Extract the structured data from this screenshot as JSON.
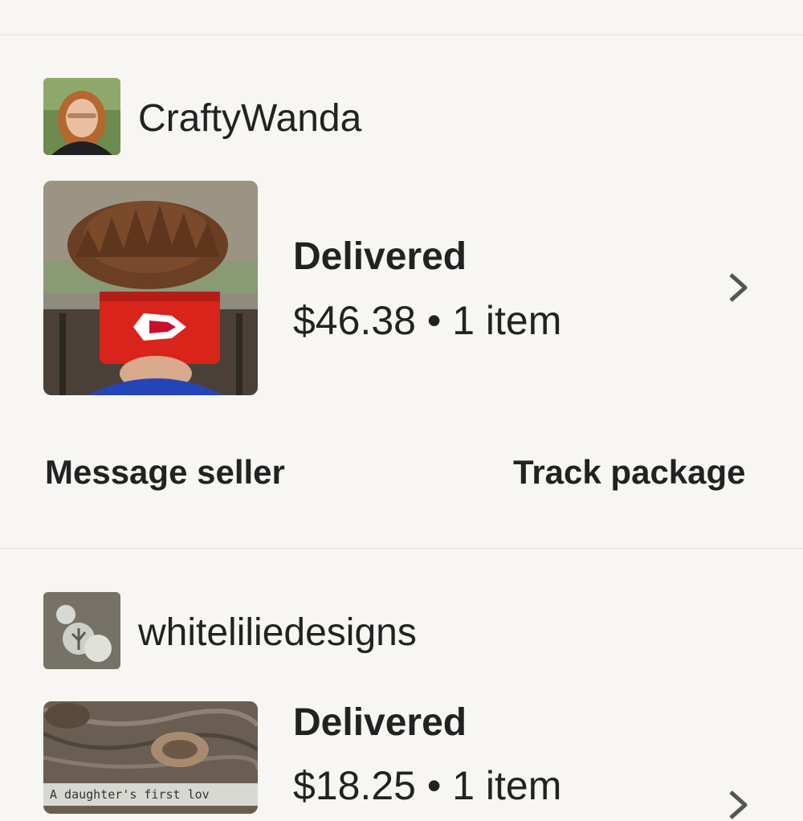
{
  "orders": [
    {
      "shop_name": "CraftyWanda",
      "status": "Delivered",
      "summary": "$46.38 • 1 item",
      "actions": {
        "message_label": "Message seller",
        "track_label": "Track package"
      }
    },
    {
      "shop_name": "whiteliliedesigns",
      "status": "Delivered",
      "summary": "$18.25 • 1 item",
      "product_text": "A daughter's first lov"
    }
  ],
  "icons": {
    "chevron": "chevron-right-icon"
  },
  "colors": {
    "background": "#f7f6f3",
    "text": "#222222",
    "divider": "#e2e0db",
    "chevron": "#555555"
  }
}
